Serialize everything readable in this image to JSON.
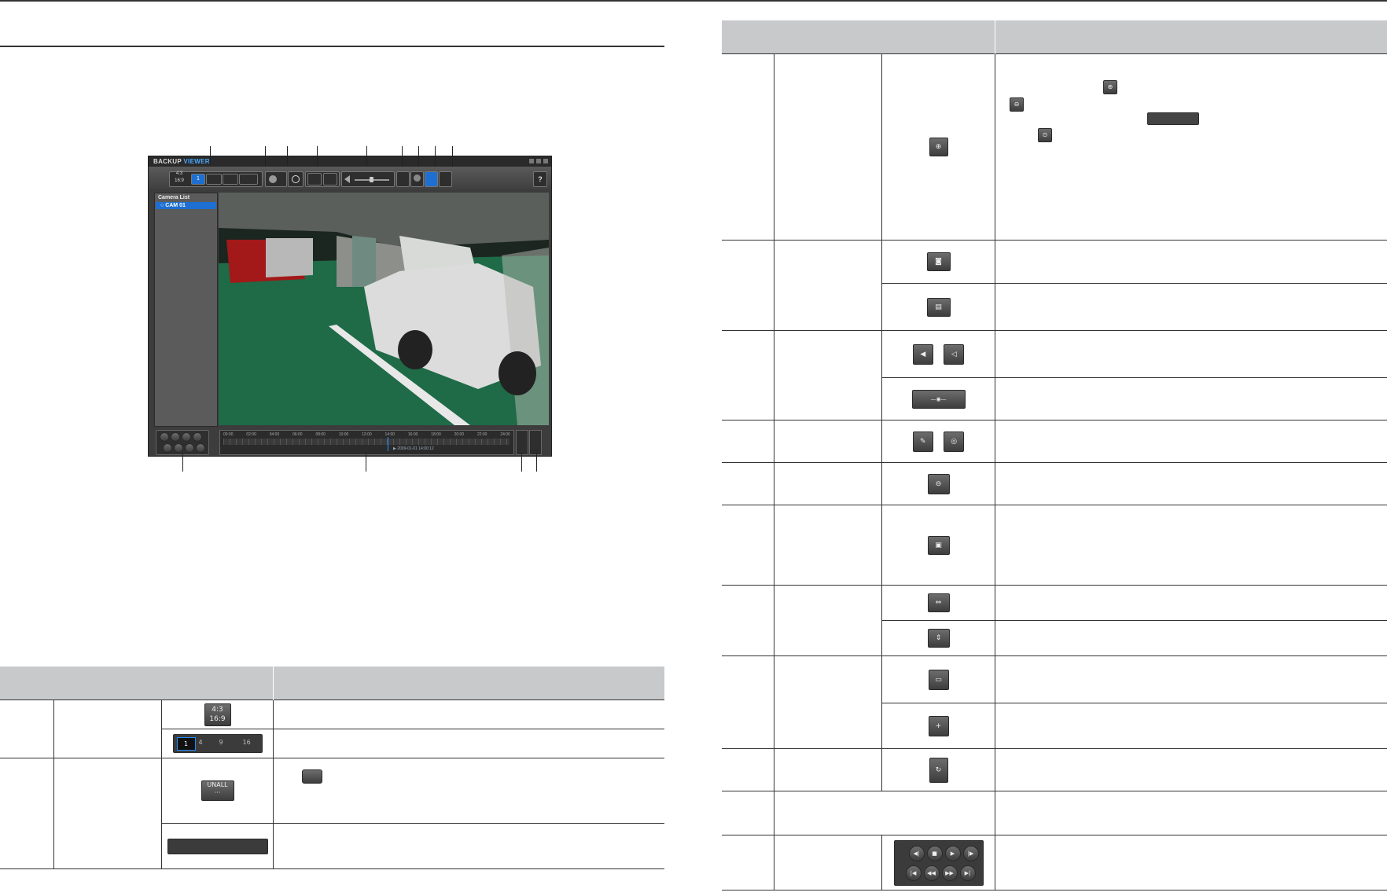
{
  "app": {
    "title_prefix": "BACKUP",
    "title_suffix": "VIEWER",
    "camera_list_header": "Camera List",
    "camera_item": "CAM 01",
    "ratio_top": "4:3",
    "ratio_bottom": "16:9",
    "split_options": [
      "1",
      "4",
      "9",
      "16"
    ],
    "timeline_ticks": [
      "00:00",
      "02:00",
      "04:00",
      "06:00",
      "08:00",
      "10:00",
      "12:00",
      "14:00",
      "16:00",
      "18:00",
      "20:00",
      "22:00",
      "24:00"
    ],
    "timeline_status": "▶ 2009-01-01 14:00:12",
    "help_label": "?"
  },
  "left_table": {
    "rows": [
      {
        "icon_text_top": "4:3",
        "icon_text_bottom": "16:9"
      },
      {
        "split_labels": [
          "1",
          "4",
          "9",
          "16"
        ]
      },
      {
        "icon_text": "UNALL"
      },
      {}
    ]
  },
  "right_table": {
    "rows": 18
  },
  "icons": {
    "zoom": "zoom-in-icon",
    "capture": "camera-icon",
    "print": "print-icon",
    "audio": "speaker-icon",
    "volume": "volume-slider-icon",
    "deinterlace": "deinterlace-icon",
    "ptz": "ptz-icon",
    "fullscreen": "fullscreen-icon",
    "layout": "layout-icon",
    "timeline_minus": "zoom-out-icon",
    "timeline_plus": "zoom-in-icon",
    "rotate": "rotate-icon",
    "playback": "playback-controls-icon"
  }
}
